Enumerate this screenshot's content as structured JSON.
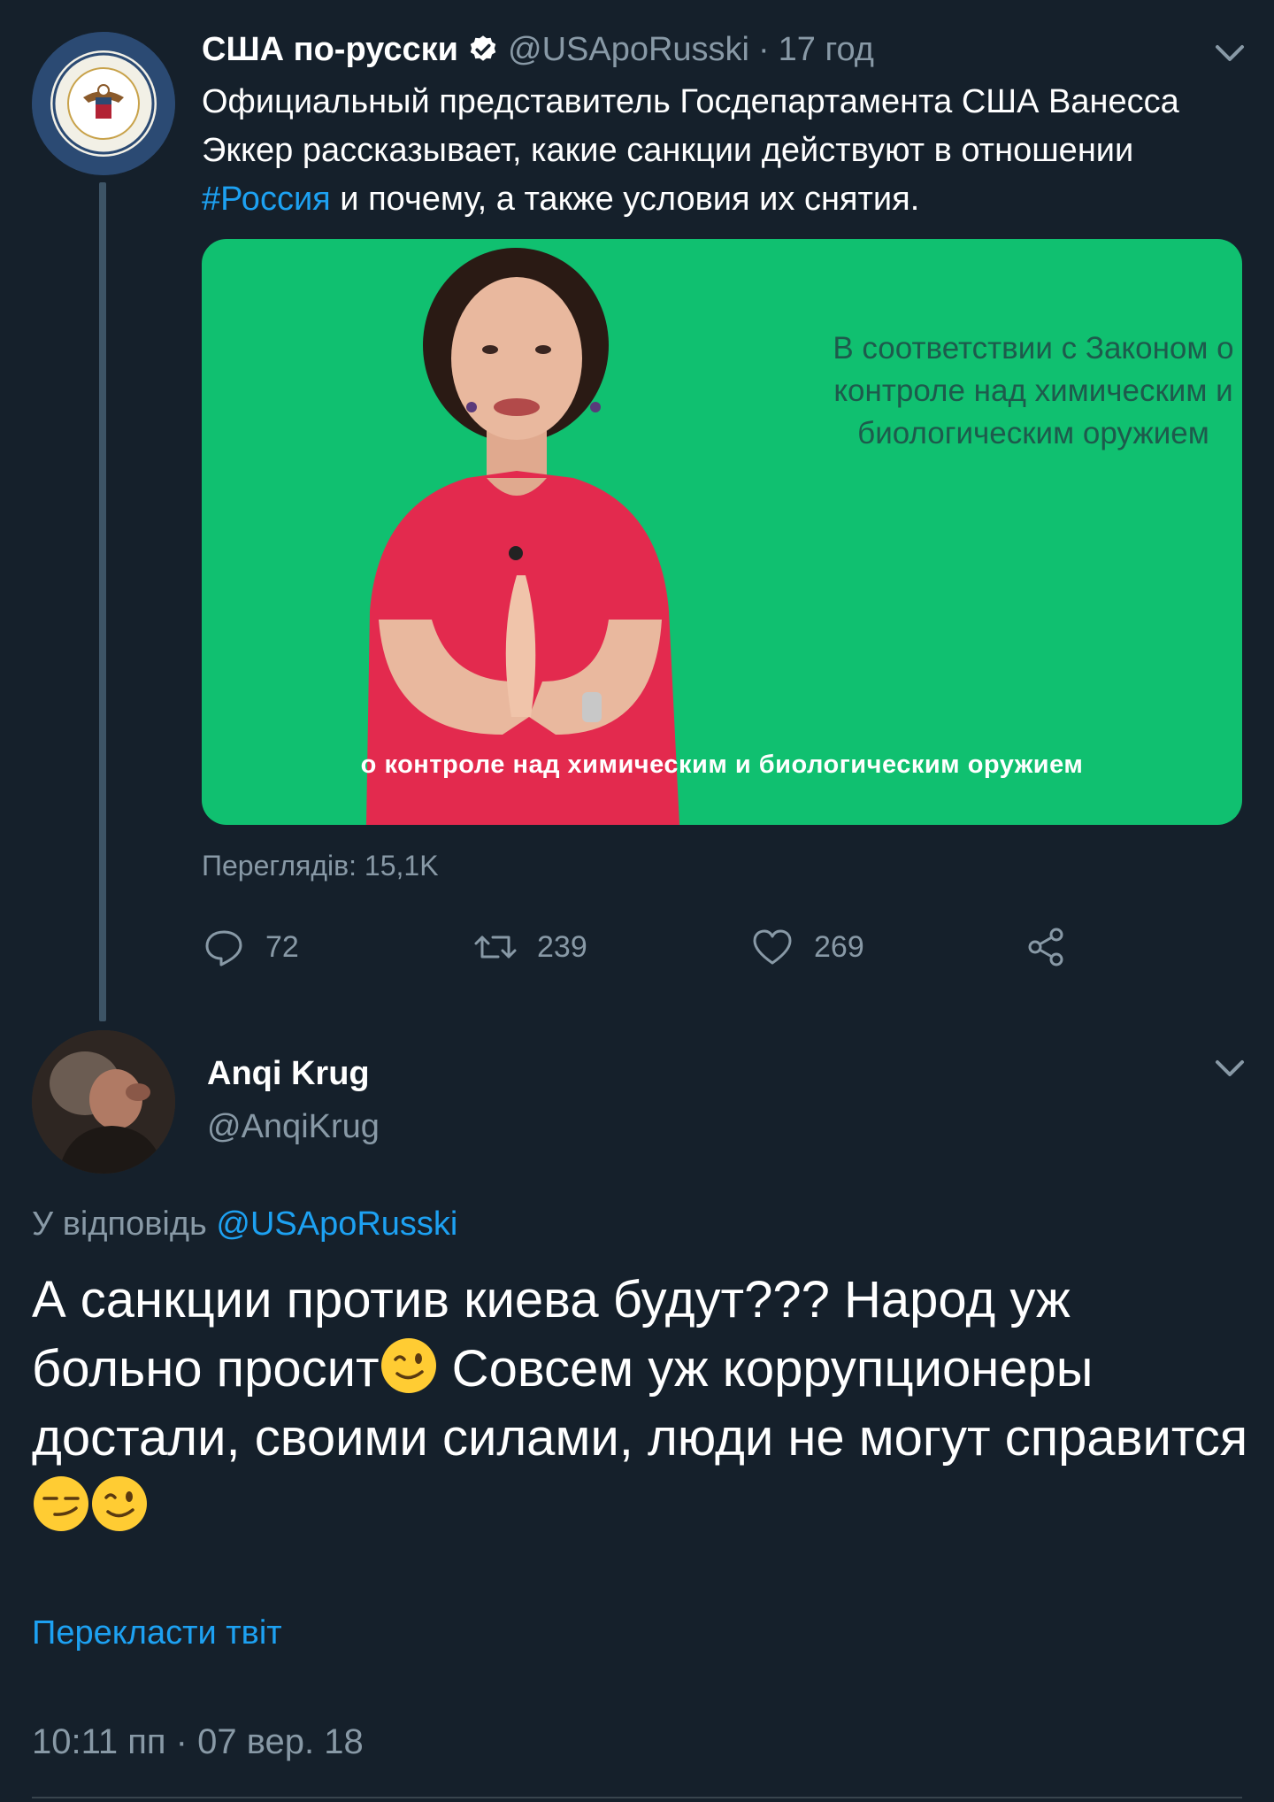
{
  "tweet": {
    "author_name": "США по-русски",
    "author_handle": "@USApoRusski",
    "separator": "·",
    "time": "17 год",
    "text_before": "Официальный представитель Госдепартамента США Ванесса Эккер рассказывает, какие санкции действуют в отношении ",
    "hashtag": "#Россия",
    "text_after": " и почему, а также условия их снятия.",
    "media": {
      "overlay_text": "В соответствии с Законом о контроле над химическим и биологическим оружием",
      "caption": "о контроле над химическим и биологическим оружием",
      "background_color": "#10c070"
    },
    "views": "Переглядів: 15,1K",
    "actions": {
      "reply_count": "72",
      "retweet_count": "239",
      "like_count": "269"
    }
  },
  "reply": {
    "author_name": "Anqi Krug",
    "author_handle": "@AnqiKrug",
    "reply_to_label": "У відповідь",
    "reply_to_handle": "@USApoRusski",
    "text_1": "А санкции против киева будут??? Народ уж больно просит",
    "text_2": " Совсем уж коррупционеры достали, своими силами, люди не могут справится",
    "translate_label": "Перекласти твіт",
    "timestamp": "10:11 пп · 07 вер. 18"
  },
  "colors": {
    "background": "#15202b",
    "accent": "#1da1f2",
    "muted": "#8899a6"
  },
  "icons": [
    "verified-badge-icon",
    "chevron-down-icon",
    "reply-icon",
    "retweet-icon",
    "like-icon",
    "share-icon",
    "wink-emoji-icon",
    "smirk-emoji-icon"
  ]
}
